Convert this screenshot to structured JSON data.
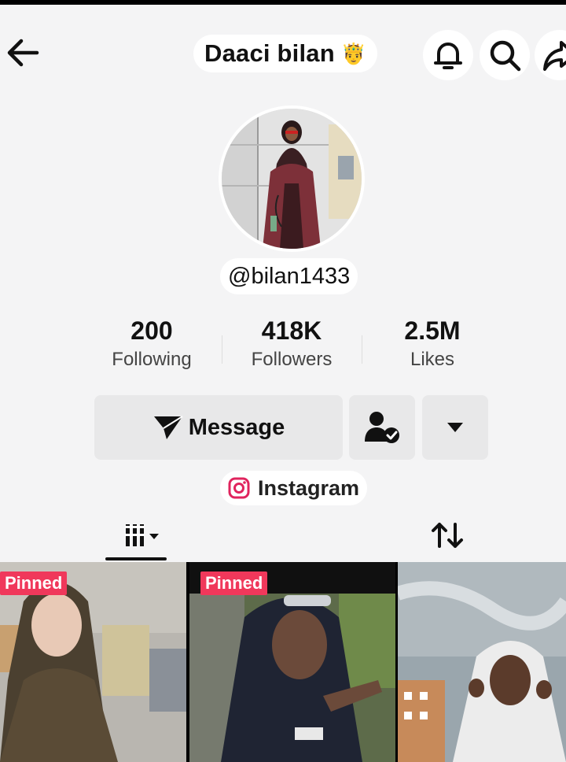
{
  "header": {
    "title": "Daaci bilan",
    "title_emoji": "🤴",
    "icons": [
      "back-arrow-icon",
      "bell-icon",
      "search-icon",
      "share-icon"
    ]
  },
  "profile": {
    "username": "@bilan1433"
  },
  "stats": [
    {
      "value": "200",
      "label": "Following"
    },
    {
      "value": "418K",
      "label": "Followers"
    },
    {
      "value": "2.5M",
      "label": "Likes"
    }
  ],
  "actions": {
    "message_label": "Message",
    "friends_icon": "person-check-icon",
    "more_icon": "dropdown-triangle-icon"
  },
  "links": {
    "instagram_label": "Instagram"
  },
  "tabs": {
    "videos_icon": "grid-videos-icon",
    "reposts_icon": "repost-icon"
  },
  "videos": [
    {
      "pinned_label": "Pinned"
    },
    {
      "pinned_label": "Pinned"
    },
    {
      "pinned_label": ""
    }
  ],
  "colors": {
    "pinned_badge": "#f0385b",
    "background": "#f4f4f5",
    "button_bg": "#e8e8e9"
  }
}
